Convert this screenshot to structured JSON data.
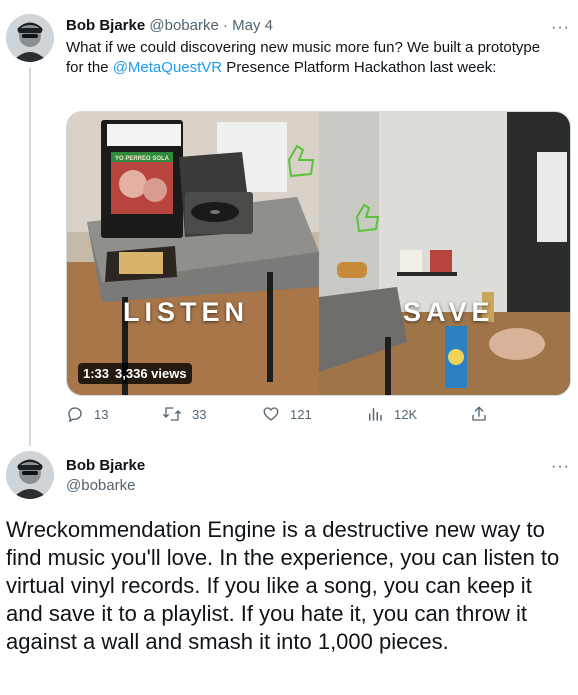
{
  "tweet1": {
    "author_name": "Bob Bjarke",
    "handle": "@bobarke",
    "separator": "·",
    "date": "May 4",
    "text_before": "What if we could discovering new music more fun? We built a prototype for the ",
    "mention": "@MetaQuestVR",
    "text_after": "  Presence Platform Hackathon last week:",
    "more_label": "···",
    "media": {
      "overlay_left": "LISTEN",
      "overlay_right": "SAVE",
      "record_label": "YO PERREO SOLA",
      "duration": "1:33",
      "views": "3,336 views"
    },
    "actions": {
      "replies": "13",
      "retweets": "33",
      "likes": "121",
      "views": "12K"
    },
    "icons": [
      "reply-icon",
      "retweet-icon",
      "like-icon",
      "views-icon",
      "share-icon"
    ]
  },
  "tweet2": {
    "author_name": "Bob Bjarke",
    "handle": "@bobarke",
    "more_label": "···",
    "text": "Wreckommendation Engine is a destructive new way to find music you'll love. In the experience, you can listen to virtual vinyl records. If you like a song, you can keep it and save it to a playlist. If you hate it, you can throw it against a wall and smash it into 1,000 pieces."
  },
  "colors": {
    "text": "#0f1419",
    "muted": "#536471",
    "link": "#1d9bf0",
    "thread_line": "#cfd9de"
  }
}
